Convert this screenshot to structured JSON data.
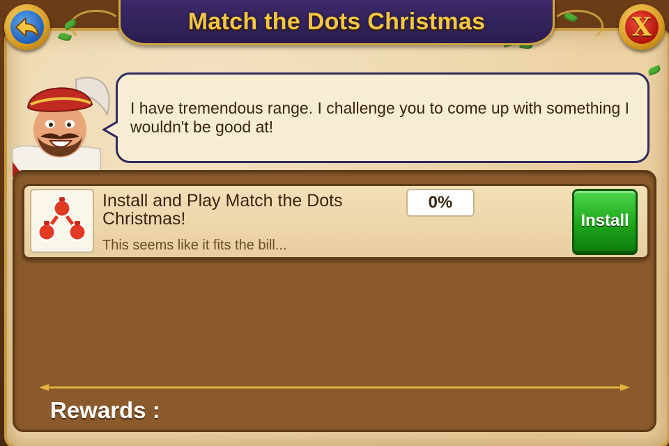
{
  "header": {
    "title": "Match the Dots Christmas"
  },
  "buttons": {
    "back_icon": "back-arrow-icon",
    "close_label": "X"
  },
  "character": {
    "icon": "jester-character-icon"
  },
  "speech": {
    "text": "I have tremendous range. I challenge you to come up with something I wouldn't be good at!"
  },
  "offer": {
    "icon": "dots-ornament-icon",
    "title": "Install and Play Match the Dots Christmas!",
    "subtitle": "This seems like it fits the bill...",
    "progress": "0%",
    "install_label": "Install"
  },
  "rewards": {
    "label": "Rewards :"
  },
  "colors": {
    "title": "#f4c642",
    "banner": "#2a1c4e",
    "install_green": "#1ea71a",
    "panel_brown": "#8a5a2c"
  }
}
